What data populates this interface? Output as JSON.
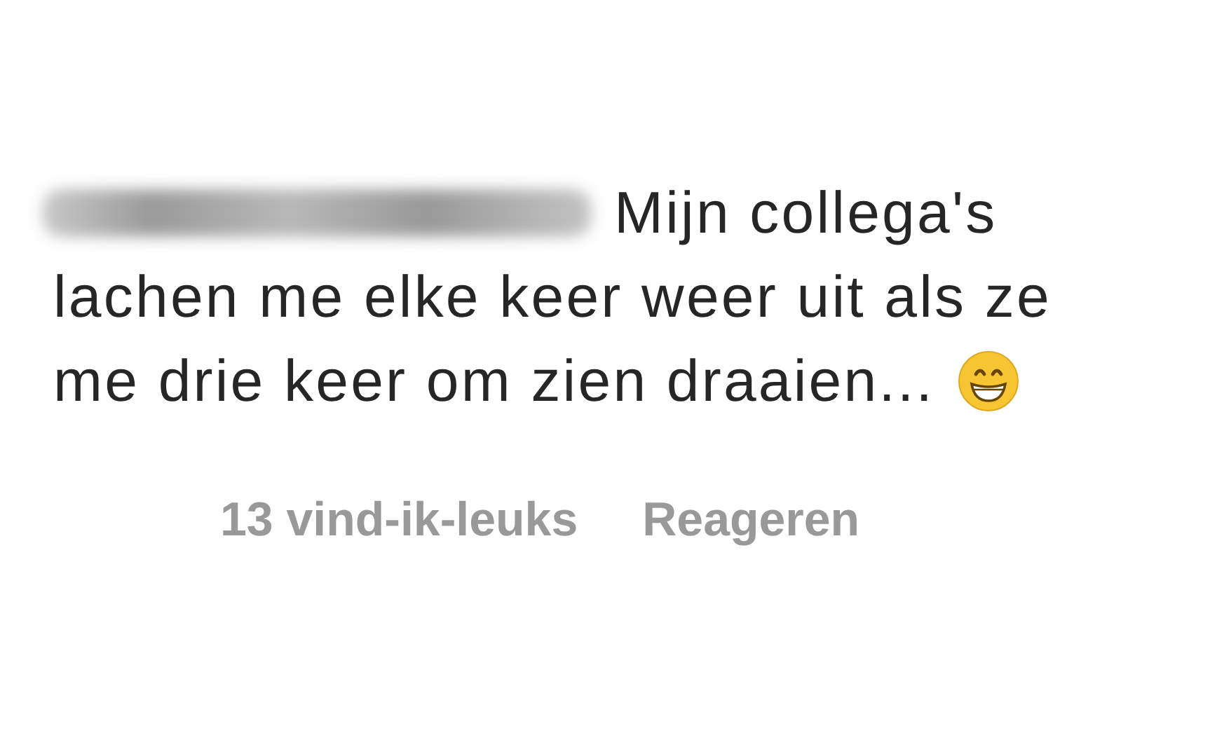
{
  "comment": {
    "author": {
      "blurred": true
    },
    "lines": [
      "Mijn collega's",
      "lachen me elke keer weer uit als ze",
      "me drie keer om zien draaien..."
    ]
  },
  "actions": [
    {
      "label": "13 vind-ik-leuks"
    },
    {
      "label": "Reageren"
    }
  ]
}
